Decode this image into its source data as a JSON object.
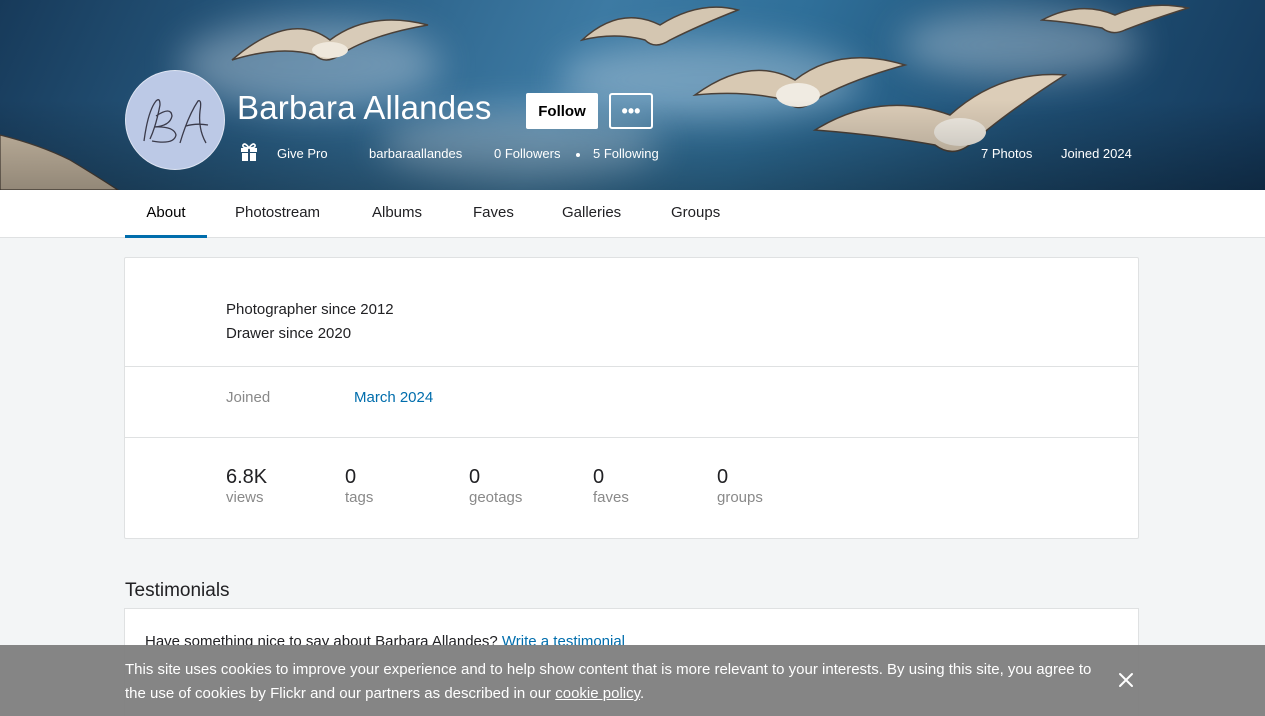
{
  "profile": {
    "name": "Barbara Allandes",
    "avatar_initials": "BA",
    "follow_label": "Follow",
    "more_label": "•••",
    "give_pro_label": "Give Pro",
    "username": "barbaraallandes",
    "followers": "0 Followers",
    "following": "5 Following",
    "photos_count": "7 Photos",
    "joined_year": "Joined 2024"
  },
  "tabs": [
    {
      "label": "About",
      "active": true
    },
    {
      "label": "Photostream",
      "active": false
    },
    {
      "label": "Albums",
      "active": false
    },
    {
      "label": "Faves",
      "active": false
    },
    {
      "label": "Galleries",
      "active": false
    },
    {
      "label": "Groups",
      "active": false
    }
  ],
  "about": {
    "bio": [
      "Photographer since 2012",
      "Drawer since 2020"
    ],
    "joined_label": "Joined",
    "joined_value": "March 2024",
    "stats": [
      {
        "value": "6.8K",
        "label": "views"
      },
      {
        "value": "0",
        "label": "tags"
      },
      {
        "value": "0",
        "label": "geotags"
      },
      {
        "value": "0",
        "label": "faves"
      },
      {
        "value": "0",
        "label": "groups"
      }
    ]
  },
  "testimonials": {
    "title": "Testimonials",
    "prompt": "Have something nice to say about Barbara Allandes?",
    "link": "Write a testimonial"
  },
  "cookie_banner": {
    "text": "This site uses cookies to improve your experience and to help show content that is more relevant to your interests. By using this site, you agree to the use of cookies by Flickr and our partners as described in our",
    "link": "cookie policy",
    "end": "."
  },
  "colors": {
    "accent": "#006dac",
    "muted_text": "#898989",
    "page_bg": "#f3f5f6",
    "banner_bg": "#808080"
  }
}
